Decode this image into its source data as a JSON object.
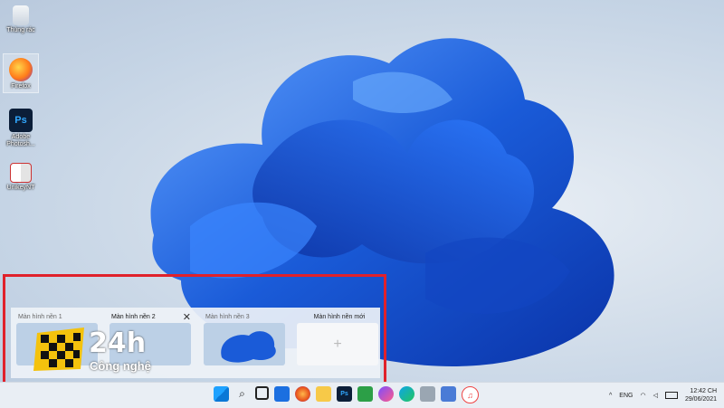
{
  "desktop": {
    "icons": [
      {
        "label": "Thùng rác",
        "icon": "recycle-bin-icon"
      },
      {
        "label": "Firefox",
        "icon": "firefox-icon"
      },
      {
        "label": "Adobe Photosh...",
        "icon": "photoshop-icon"
      },
      {
        "label": "UnikeyNT",
        "icon": "unikey-icon"
      }
    ]
  },
  "virtual_desktops": [
    {
      "title": "Màn hình nền 1"
    },
    {
      "title": "Màn hình nền 2",
      "close": "✕"
    },
    {
      "title": "Màn hình nền 3"
    },
    {
      "title": "Màn hình nền mới",
      "plus": "+"
    }
  ],
  "watermark": {
    "num": "24h",
    "sub": "Công nghệ"
  },
  "taskbar": {
    "apps": [
      "windows-start-icon",
      "search-icon",
      "task-view-icon",
      "widgets-icon",
      "firefox-icon",
      "file-explorer-icon",
      "photoshop-icon",
      "store-icon",
      "messenger-icon",
      "edge-icon",
      "app-icon",
      "calendar-icon",
      "itunes-icon"
    ],
    "tray": {
      "chevron": "^",
      "lang": "ENG",
      "time": "12:42 CH",
      "date": "29/06/2021"
    }
  },
  "colors": {
    "highlight_border": "#e0212b",
    "bloom": "#1a5bd8"
  }
}
